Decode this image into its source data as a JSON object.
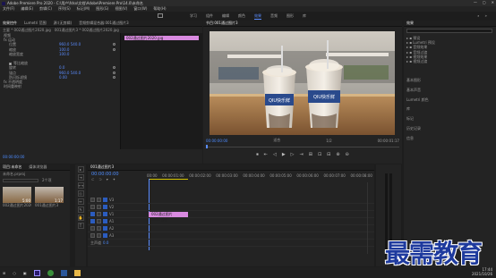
{
  "window": {
    "title": "Adobe Premiere Pro 2020 - C:\\用户\\fdsx\\文档\\Adobe\\Premiere Pro\\14.0\\未命名",
    "controls": [
      "—",
      "▢",
      "✕"
    ]
  },
  "menu": [
    "文件(F)",
    "编辑(E)",
    "剪辑(C)",
    "序列(S)",
    "标记(M)",
    "图形(G)",
    "视图(V)",
    "窗口(W)",
    "帮助(H)"
  ],
  "workspaces": [
    "学习",
    "组件",
    "编辑",
    "颜色",
    "效果",
    "音频",
    "图形",
    "库"
  ],
  "workspace_active": "效果",
  "effect_controls": {
    "tabs": [
      "效果控件",
      "Lumetri 范围",
      "源:(无剪辑)",
      "音频剪辑混合器:001通过图片3"
    ],
    "master": "主要 * 002通过图片2020.jpg",
    "seq": "001通过图片3 * 002通过图片2020.jpg",
    "sections": [
      "视频",
      "fx 运动",
      "位置",
      "缩放",
      "缩放宽度",
      "",
      "等比缩放",
      "旋转",
      "锚点",
      "防闪烁滤镜",
      "fx 不透明度",
      "时间重映射"
    ],
    "values": [
      "",
      "",
      "960.0  540.0",
      "100.0",
      "100.0",
      "",
      "",
      "0.0",
      "960.0  540.0",
      "0.00",
      "",
      ""
    ],
    "clip_label": "002通过图片2020.jpg",
    "ec_timecode": "00:00:00:00"
  },
  "program": {
    "tab": "节目:001通过图片3",
    "timecode_left": "00:00:00:00",
    "fit": "适合",
    "scale": "1/2",
    "timecode_right": "00:00:01:17",
    "controls": [
      "⏹",
      "⇤",
      "◁",
      "▶",
      "▷",
      "⇥",
      "⊞",
      "⊡",
      "⊟",
      "⊕",
      "⊖"
    ],
    "cup_text_1": "QIU快乐鲜",
    "cup_text_2": "QIU快乐鲜"
  },
  "project": {
    "tabs": [
      "项目:未命名",
      "媒体浏览器"
    ],
    "file": "未命名.prproj",
    "search_placeholder": "",
    "count": "2个项",
    "items": [
      {
        "label": "002通过图片2020",
        "dur": "5:00"
      },
      {
        "label": "001通过图片3",
        "dur": "1:17"
      }
    ]
  },
  "timeline": {
    "tab": "001通过图片3",
    "timecode": "00:00:00:00",
    "ruler": [
      "00:00",
      "00:00:01:00",
      "00:00:02:00",
      "00:00:03:00",
      "00:00:04:00",
      "00:00:05:00",
      "00:00:06:00",
      "00:00:07:00",
      "00:00:08:00"
    ],
    "tracks": [
      {
        "id": "V3"
      },
      {
        "id": "V2"
      },
      {
        "id": "V1"
      },
      {
        "id": "A1"
      },
      {
        "id": "A2"
      },
      {
        "id": "A3"
      },
      {
        "id": "主声道"
      }
    ],
    "clip": "002通过图片2020.jpg",
    "master_value": "0.0"
  },
  "effects_panel": {
    "tab": "效果",
    "items": [
      "预设",
      "Lumetri 预设",
      "音频效果",
      "音频过渡",
      "视频效果",
      "视频过渡"
    ],
    "lists": [
      "基本图形",
      "基本声音",
      "Lumetri 颜色",
      "库",
      "标记",
      "历史记录",
      "信息"
    ]
  },
  "taskbar": {
    "time": "17:44",
    "date": "2021/10/26"
  },
  "watermark": "最需教育",
  "colors": {
    "accent": "#5a8cff",
    "clip": "#d98ae0",
    "active_ws": "#5a8cff"
  }
}
